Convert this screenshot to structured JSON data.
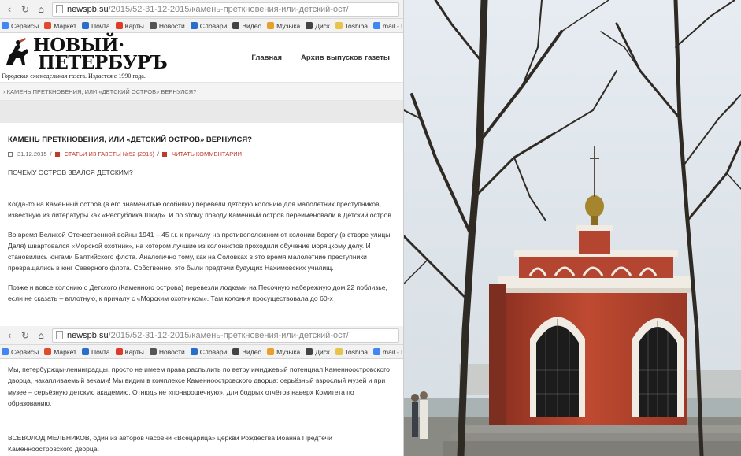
{
  "browser": {
    "url_host": "newspb.su",
    "url_path": "/2015/52-31-12-2015/камень-преткновения-или-детский-ост/",
    "bookmarks": [
      {
        "label": "Сервисы",
        "color": "#4285f4"
      },
      {
        "label": "Маркет",
        "color": "#e04b2b"
      },
      {
        "label": "Почта",
        "color": "#2a6ecc"
      },
      {
        "label": "Карты",
        "color": "#e03a2b"
      },
      {
        "label": "Новости",
        "color": "#555555"
      },
      {
        "label": "Словари",
        "color": "#2a6ecc"
      },
      {
        "label": "Видео",
        "color": "#444444"
      },
      {
        "label": "Музыка",
        "color": "#e8a02b"
      },
      {
        "label": "Диск",
        "color": "#444444"
      },
      {
        "label": "Toshiba",
        "color": "#e8c44a"
      },
      {
        "label": "mail - Поиск в Google",
        "color": "#4285f4"
      }
    ]
  },
  "site": {
    "logo_line1": "НОВЫЙ·",
    "logo_line2": "ПЕТЕРБУРЪ",
    "logo_sub": "Городская еженедельная газета. Издается с 1990 года.",
    "nav": [
      "Главная",
      "Архив выпусков газеты"
    ]
  },
  "breadcrumb": "› КАМЕНЬ ПРЕТКНОВЕНИЯ, ИЛИ «ДЕТСКИЙ ОСТРОВ» ВЕРНУЛСЯ?",
  "article": {
    "title": "КАМЕНЬ ПРЕТКНОВЕНИЯ, ИЛИ «ДЕТСКИЙ ОСТРОВ» ВЕРНУЛСЯ?",
    "date": "31.12.2015",
    "category": "СТАТЬИ ИЗ ГАЗЕТЫ №52 (2015)",
    "comments": "ЧИТАТЬ КОММЕНТАРИИ",
    "subhead": "ПОЧЕМУ ОСТРОВ ЗВАЛСЯ ДЕТСКИМ?",
    "paragraphs": [
      "Когда-то на Каменный остров (в его знаменитые особняки) перевели детскую колонию для малолетних преступников, известную из литературы как «Республика Шкид». И по этому поводу Каменный остров переименовали в Детский остров.",
      "Во время Великой Отечественной войны 1941 – 45 г.г. к причалу на противоположном от колонии берегу (в створе улицы Даля) швартовался «Морской охотник», на котором лучшие из колонистов проходили обучение моряцкому делу. И становились юнгами Балтийского флота. Аналогично тому, как на Соловках в это время малолетние преступники превращались в юнг Северного флота. Собственно, это были предтечи будущих Нахимовских училищ.",
      "Позже и вовсе колонию с Детского (Каменного острова) перевезли лодками на Песочную набережную дом 22 поблизье, если не сказать – вплотную, к причалу с «Морским охотником». Там колония просуществовала до 60-х"
    ],
    "continued": "Мы, петербуржцы-ленинградцы, просто не имеем права распылить по ветру имиджевый потенциал Каменноостровского дворца, накапливаемый веками! Мы видим в комплексе Каменноостровского дворца: серьёзный взрослый музей и при музее – серьёзную детскую академию. Отнюдь не «понарошечную», для бодрых отчётов наверх Комитета по образованию.",
    "signature": "ВСЕВОЛОД МЕЛЬНИКОВ, один из авторов часовни «Всецарица» церкви Рождества Иоанна Предтечи Каменноостровского дворца."
  },
  "colors": {
    "accent_red": "#c0392b",
    "chapel_brick": "#b8452e",
    "chapel_trim": "#f0ece4",
    "sky": "#dfe6ec"
  }
}
